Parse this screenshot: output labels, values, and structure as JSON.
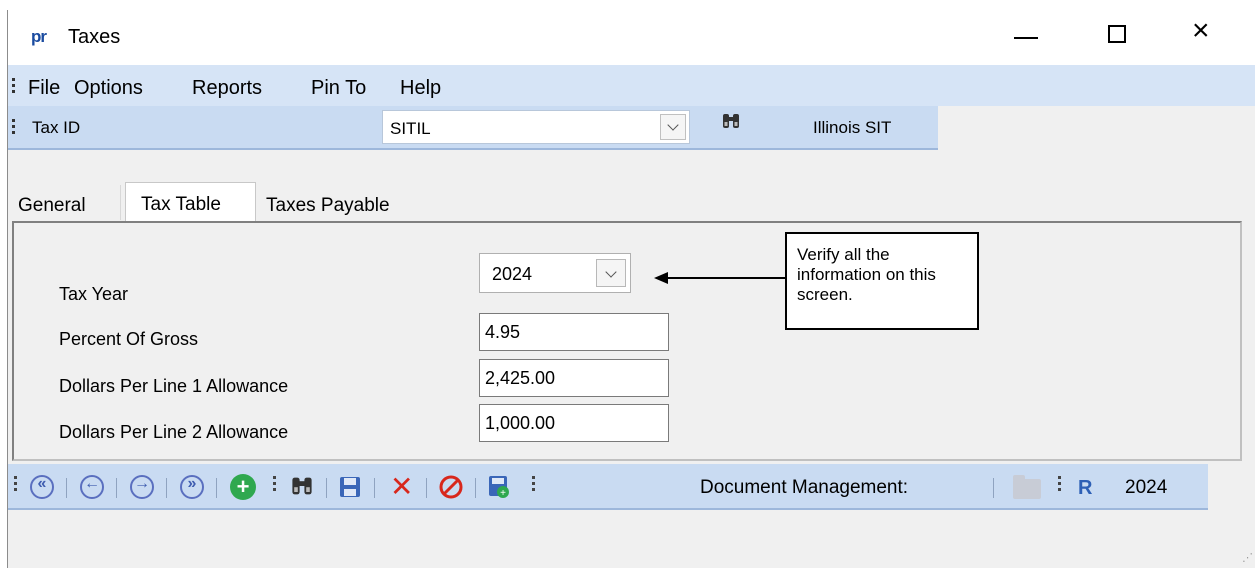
{
  "window": {
    "app_logo": "pr",
    "title": "Taxes",
    "minimize_label": "",
    "maximize_label": "",
    "close_label": "×"
  },
  "menu": {
    "items": [
      "File",
      "Options",
      "Reports",
      "Pin To",
      "Help"
    ]
  },
  "taxbar": {
    "label": "Tax ID",
    "value": "SITIL",
    "description": "Illinois SIT",
    "search_icon": "binoculars-icon"
  },
  "tabs": [
    {
      "label": "General",
      "active": false
    },
    {
      "label": "Tax Table",
      "active": true
    },
    {
      "label": "Taxes Payable",
      "active": false
    }
  ],
  "form": {
    "tax_year_label": "Tax Year",
    "tax_year_value": "2024",
    "percent_gross_label": "Percent Of Gross",
    "percent_gross_value": "4.95",
    "line1_label": "Dollars Per Line 1 Allowance",
    "line1_value": "2,425.00",
    "line2_label": "Dollars Per Line 2 Allowance",
    "line2_value": "1,000.00"
  },
  "callout": {
    "text": "Verify all the information on this screen."
  },
  "toolbar": {
    "first_icon": "first-record-icon",
    "prev_icon": "previous-record-icon",
    "next_icon": "next-record-icon",
    "last_icon": "last-record-icon",
    "add_icon": "add-icon",
    "find_icon": "binoculars-icon",
    "save_icon": "save-icon",
    "delete_icon": "delete-icon",
    "cancel_icon": "cancel-icon",
    "export_icon": "export-icon",
    "document_management_label": "Document Management:",
    "year": "2024",
    "accent_color": "#c9dbf2"
  }
}
